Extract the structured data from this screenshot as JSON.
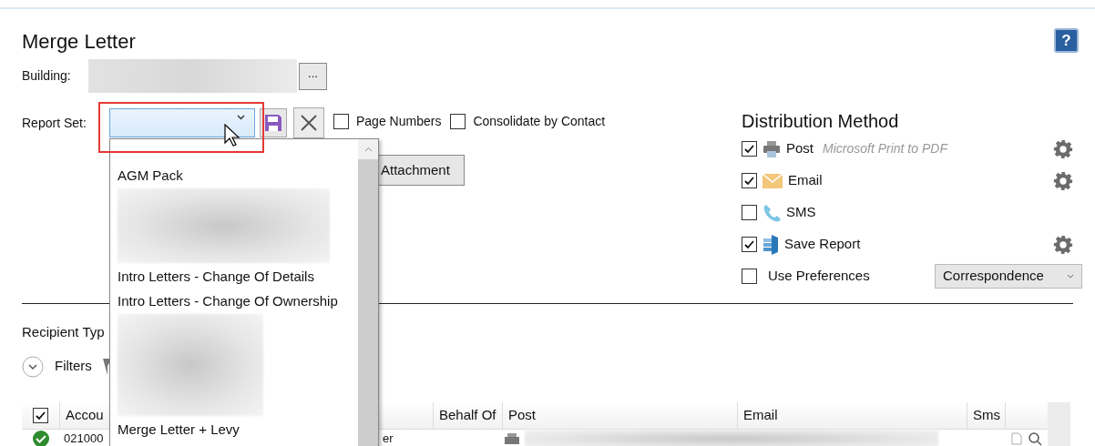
{
  "title": "Merge Letter",
  "help": "?",
  "building": {
    "label": "Building:",
    "browse": "..."
  },
  "report_set": {
    "label": "Report Set:",
    "highlighted": true,
    "options": [
      {
        "label": "Page Numbers",
        "checked": false
      },
      {
        "label": "Consolidate by Contact",
        "checked": false
      }
    ]
  },
  "attachment_button": "Attachment",
  "dropdown": {
    "items": [
      {
        "kind": "text",
        "label": "AGM Pack"
      },
      {
        "kind": "redacted"
      },
      {
        "kind": "text",
        "label": "Intro Letters - Change Of Details"
      },
      {
        "kind": "text",
        "label": "Intro Letters - Change Of Ownership"
      },
      {
        "kind": "redacted"
      },
      {
        "kind": "text",
        "label": "Merge Letter + Levy"
      }
    ]
  },
  "distribution": {
    "title": "Distribution Method",
    "methods": [
      {
        "kind": "post",
        "label": "Post",
        "detail": "Microsoft Print to PDF",
        "checked": true,
        "settings": true
      },
      {
        "kind": "email",
        "label": "Email",
        "checked": true,
        "settings": true
      },
      {
        "kind": "sms",
        "label": "SMS",
        "checked": false,
        "settings": false
      },
      {
        "kind": "save",
        "label": "Save Report",
        "checked": true,
        "settings": true
      }
    ],
    "use_preferences": {
      "label": "Use Preferences",
      "checked": false
    },
    "preference_select": "Correspondence"
  },
  "recipient_type_label": "Recipient Typ",
  "filters": "Filters",
  "table": {
    "all_checked": true,
    "columns": [
      "Accou",
      "Behalf Of",
      "Post",
      "Email",
      "Sms"
    ],
    "rows": [
      {
        "ok": true,
        "cells": [
          "021000",
          "er"
        ]
      }
    ]
  }
}
